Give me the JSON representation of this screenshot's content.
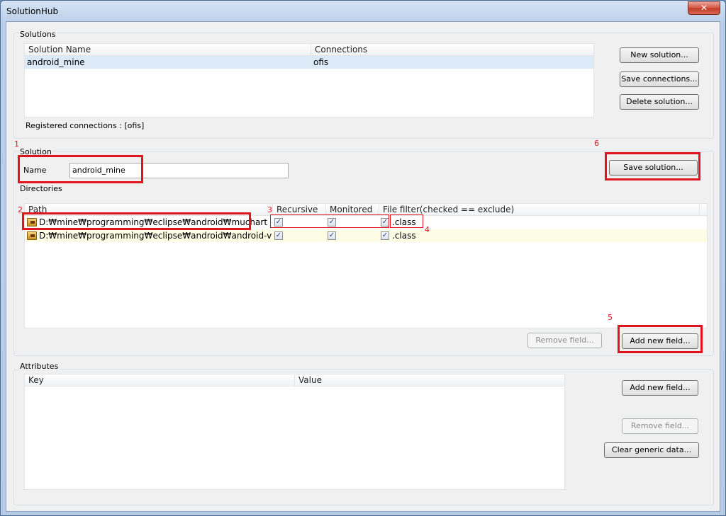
{
  "window": {
    "title": "SolutionHub",
    "close_glyph": "✕"
  },
  "solutions": {
    "group_label": "Solutions",
    "columns": [
      "Solution Name",
      "Connections"
    ],
    "rows": [
      {
        "name": "android_mine",
        "connections": "ofis"
      }
    ],
    "registered": "Registered connections : [ofis]",
    "buttons": {
      "new": "New solution...",
      "save_connections": "Save connections...",
      "delete": "Delete solution..."
    }
  },
  "solution": {
    "group_label": "Solution",
    "name_label": "Name",
    "name_value": "android_mine",
    "save_button": "Save solution..."
  },
  "directories": {
    "group_label": "Directories",
    "columns": [
      "Path",
      "Recursive",
      "Monitored",
      "File filter(checked == exclude)"
    ],
    "rows": [
      {
        "path": "D:₩mine₩programming₩eclipse₩android₩muchart",
        "recursive": true,
        "monitored": true,
        "filter_checked": true,
        "filter": ".class"
      },
      {
        "path": "D:₩mine₩programming₩eclipse₩android₩android-viewflo...",
        "recursive": true,
        "monitored": true,
        "filter_checked": true,
        "filter": ".class"
      }
    ],
    "remove_button": "Remove field...",
    "add_button": "Add new field..."
  },
  "attributes": {
    "group_label": "Attributes",
    "columns": [
      "Key",
      "Value"
    ],
    "add_button": "Add new field...",
    "remove_button": "Remove field...",
    "clear_button": "Clear generic data..."
  },
  "annotations": [
    "1",
    "2",
    "3",
    "4",
    "5",
    "6"
  ],
  "colors": {
    "highlight": "#e0141e",
    "selected_row": "#dce9f7",
    "alt_row": "#fdfde6"
  }
}
